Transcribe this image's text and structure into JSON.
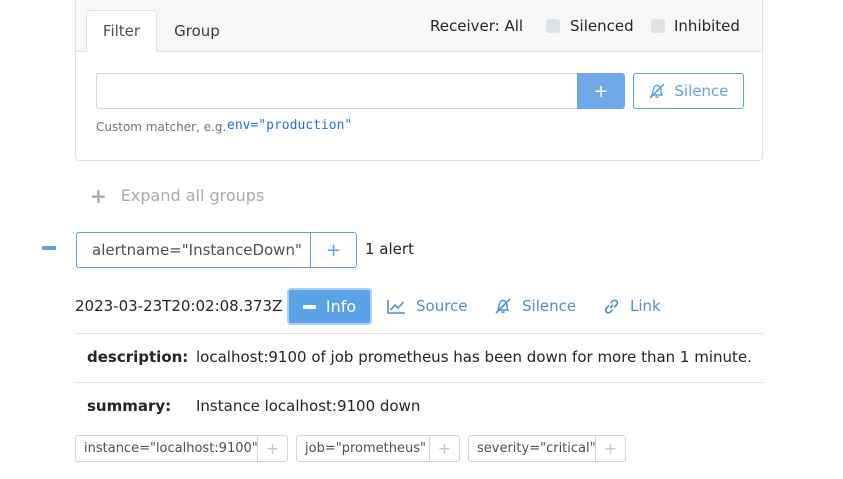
{
  "filter_bar": {
    "tabs": [
      {
        "label": "Filter",
        "active": true
      },
      {
        "label": "Group",
        "active": false
      }
    ],
    "receiver_label": "Receiver: All",
    "checkboxes": [
      {
        "label": "Silenced",
        "checked": false
      },
      {
        "label": "Inhibited",
        "checked": false
      }
    ],
    "input_value": "",
    "add_button_label": "+",
    "silence_button_label": "Silence",
    "hint_text": "Custom matcher, e.g.",
    "hint_example": "env=\"production\""
  },
  "expand_all_label": "Expand all groups",
  "group": {
    "collapse_icon": "minus-icon",
    "matcher": "alertname=\"InstanceDown\"",
    "add_label": "+",
    "alert_count": "1 alert"
  },
  "alert": {
    "timestamp": "2023-03-23T20:02:08.373Z",
    "actions": {
      "info": "Info",
      "source": "Source",
      "silence": "Silence",
      "link": "Link"
    },
    "annotations": [
      {
        "key": "description:",
        "value": "localhost:9100 of job prometheus has been down for more than 1 minute."
      },
      {
        "key": "summary:",
        "value": "Instance localhost:9100 down"
      }
    ],
    "labels": [
      {
        "text": "instance=\"localhost:9100\"",
        "add": "+"
      },
      {
        "text": "job=\"prometheus\"",
        "add": "+"
      },
      {
        "text": "severity=\"critical\"",
        "add": "+"
      }
    ]
  },
  "colors": {
    "accent": "#5ea2e4",
    "link": "#4a90d9",
    "muted": "#a6abb0"
  }
}
